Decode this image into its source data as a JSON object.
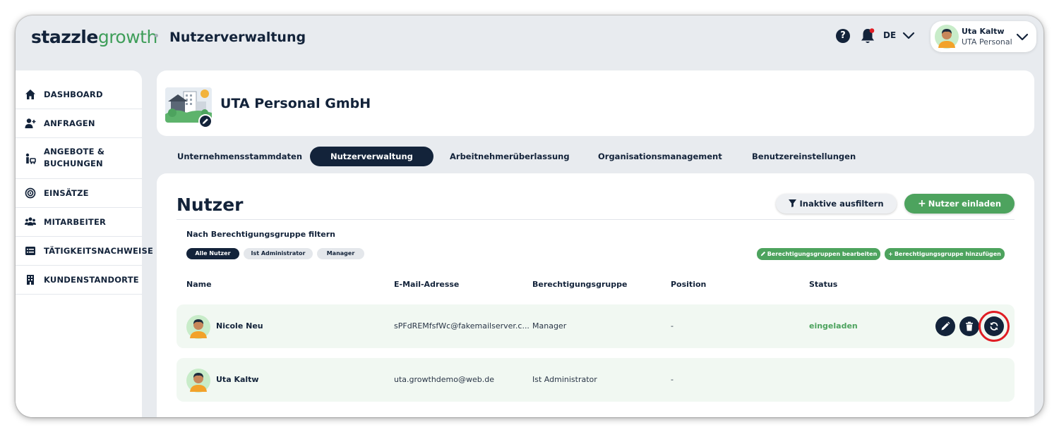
{
  "app": {
    "logo_part1": "stazzle",
    "logo_part2": "growth",
    "page_heading": "Nutzerverwaltung"
  },
  "header": {
    "help_label": "?",
    "language": "DE",
    "user": {
      "name": "Uta Kaltw",
      "company": "UTA Personal"
    }
  },
  "sidebar": {
    "items": [
      {
        "label": "DASHBOARD",
        "icon": "home-icon"
      },
      {
        "label": "ANFRAGEN",
        "icon": "user-plus-icon"
      },
      {
        "label": "ANGEBOTE &\nBUCHUNGEN",
        "icon": "person-cart-icon"
      },
      {
        "label": "EINSÄTZE",
        "icon": "target-icon"
      },
      {
        "label": "MITARBEITER",
        "icon": "users-icon"
      },
      {
        "label": "TÄTIGKEITSNACHWEISE",
        "icon": "list-icon"
      },
      {
        "label": "KUNDENSTANDORTE",
        "icon": "building-icon"
      }
    ]
  },
  "company": {
    "name": "UTA Personal GmbH"
  },
  "tabs": [
    {
      "label": "Unternehmensstammdaten",
      "active": false
    },
    {
      "label": "Nutzerverwaltung",
      "active": true
    },
    {
      "label": "Arbeitnehmerüberlassung",
      "active": false
    },
    {
      "label": "Organisationsmanagement",
      "active": false
    },
    {
      "label": "Benutzereinstellungen",
      "active": false
    }
  ],
  "main": {
    "title": "Nutzer",
    "filter_button": "Inaktive ausfiltern",
    "invite_button": "Nutzer einladen",
    "filter_label": "Nach Berechtigungsgruppe filtern",
    "filter_chips": [
      "Alle Nutzer",
      "Ist Administrator",
      "Manager"
    ],
    "edit_groups_button": "Berechtigungsgruppen bearbeiten",
    "add_group_button": "Berechtigungsgruppe hinzufügen",
    "columns": [
      "Name",
      "E-Mail-Adresse",
      "Berechtigungsgruppe",
      "Position",
      "Status"
    ],
    "rows": [
      {
        "name": "Nicole Neu",
        "email": "sPFdREMfsfWc@fakemailserver.c...",
        "group": "Manager",
        "position": "-",
        "status": "eingeladen"
      },
      {
        "name": "Uta Kaltw",
        "email": "uta.growthdemo@web.de",
        "group": "Ist Administrator",
        "position": "-",
        "status": ""
      }
    ]
  },
  "colors": {
    "navy": "#13233a",
    "green": "#4da35e",
    "background": "#e8ebef",
    "highlight": "#e01d24"
  }
}
